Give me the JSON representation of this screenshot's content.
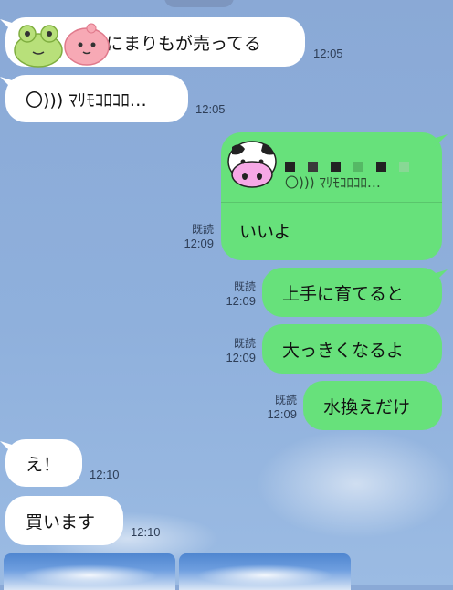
{
  "messages": [
    {
      "side": "left",
      "text": "にまりもが売ってる",
      "time": "12:05",
      "sticker": "frog-and-pink-blob"
    },
    {
      "side": "left",
      "text": "〇)))  ﾏﾘﾓｺﾛｺﾛ…",
      "time": "12:05"
    },
    {
      "side": "right",
      "reply_quote": "〇)))  ﾏﾘﾓｺﾛｺﾛ…",
      "text": "いいよ",
      "read": "既読",
      "time": "12:09"
    },
    {
      "side": "right",
      "text": "上手に育てると",
      "read": "既読",
      "time": "12:09"
    },
    {
      "side": "right",
      "text": "大っきくなるよ",
      "read": "既読",
      "time": "12:09"
    },
    {
      "side": "right",
      "text": "水換えだけ",
      "read": "既読",
      "time": "12:09"
    },
    {
      "side": "left",
      "text": "え！",
      "time": "12:10"
    },
    {
      "side": "left",
      "text": "買います",
      "time": "12:10"
    }
  ],
  "colors": {
    "bubble_right": "#67e17b",
    "bubble_left": "#ffffff",
    "background": "#8fb0dc"
  },
  "icons": {
    "reply_avatar": "cow-icon",
    "name_blocks": "censored-name-icon"
  }
}
